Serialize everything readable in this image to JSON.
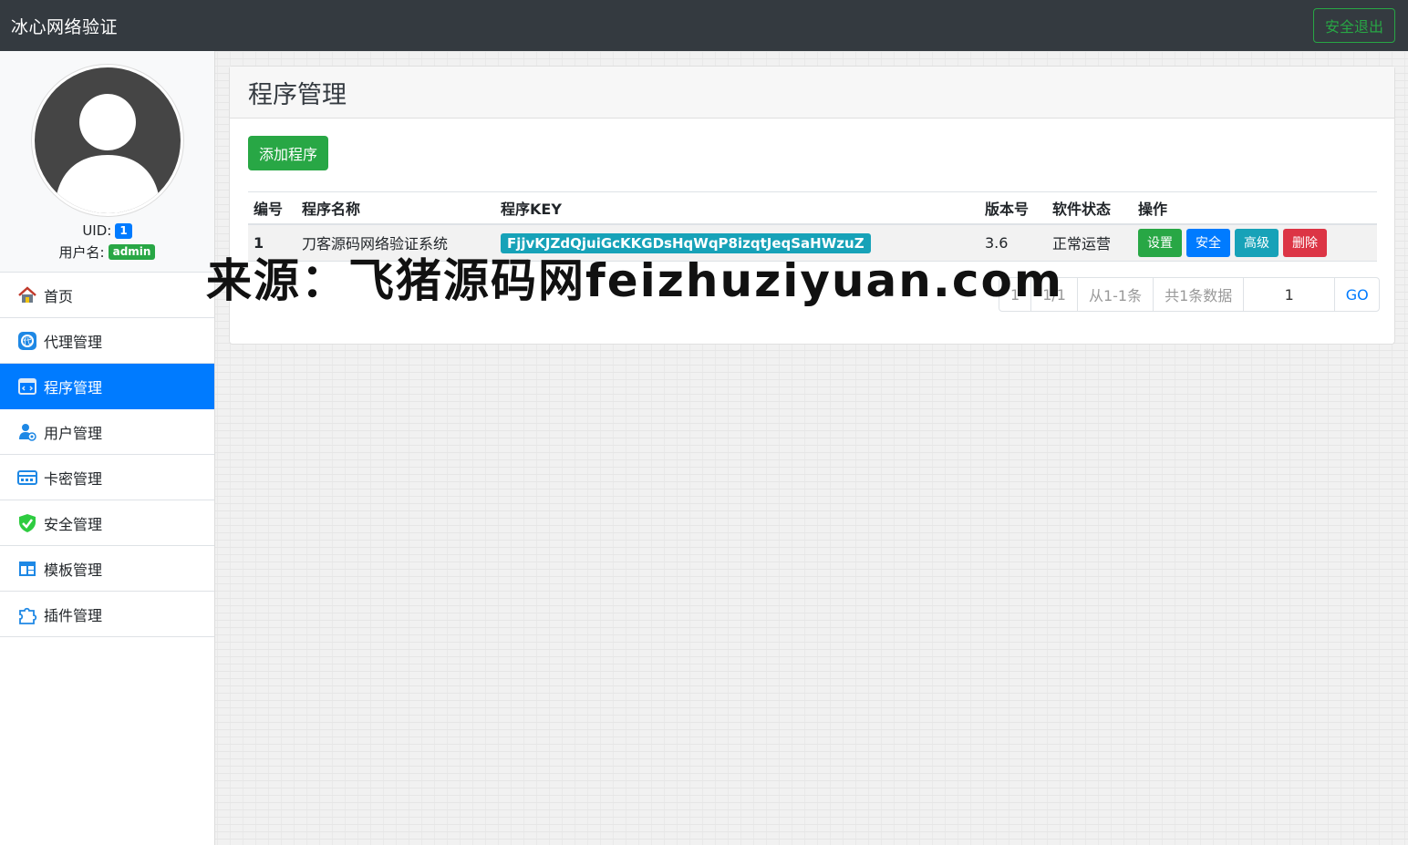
{
  "app": {
    "title": "冰心网络验证",
    "logout_label": "安全退出"
  },
  "profile": {
    "uid_label": "UID:",
    "uid_value": "1",
    "username_label": "用户名:",
    "username_value": "admin"
  },
  "sidebar": {
    "items": [
      {
        "label": "首页",
        "icon": "home-icon",
        "active": false
      },
      {
        "label": "代理管理",
        "icon": "agent-icon",
        "active": false
      },
      {
        "label": "程序管理",
        "icon": "program-icon",
        "active": true
      },
      {
        "label": "用户管理",
        "icon": "users-icon",
        "active": false
      },
      {
        "label": "卡密管理",
        "icon": "card-icon",
        "active": false
      },
      {
        "label": "安全管理",
        "icon": "shield-icon",
        "active": false
      },
      {
        "label": "模板管理",
        "icon": "template-icon",
        "active": false
      },
      {
        "label": "插件管理",
        "icon": "puzzle-icon",
        "active": false
      }
    ]
  },
  "main": {
    "title": "程序管理",
    "add_button": "添加程序",
    "table": {
      "headers": [
        "编号",
        "程序名称",
        "程序KEY",
        "版本号",
        "软件状态",
        "操作"
      ],
      "rows": [
        {
          "id": "1",
          "name": "刀客源码网络验证系统",
          "key": "FjjvKJZdQjuiGcKKGDsHqWqP8izqtJeqSaHWzuZ",
          "version": "3.6",
          "status": "正常运营",
          "actions": [
            "设置",
            "安全",
            "高级",
            "删除"
          ]
        }
      ]
    },
    "pagination": {
      "first": "1",
      "page_of": "1/1",
      "range": "从1-1条",
      "total": "共1条数据",
      "page_input": "1",
      "go": "GO"
    }
  },
  "watermark": "来源：飞猪源码网feizhuziyuan.com",
  "colors": {
    "navbar": "#343a40",
    "primary": "#007bff",
    "success": "#28a745",
    "info": "#17a2b8",
    "danger": "#dc3545"
  }
}
